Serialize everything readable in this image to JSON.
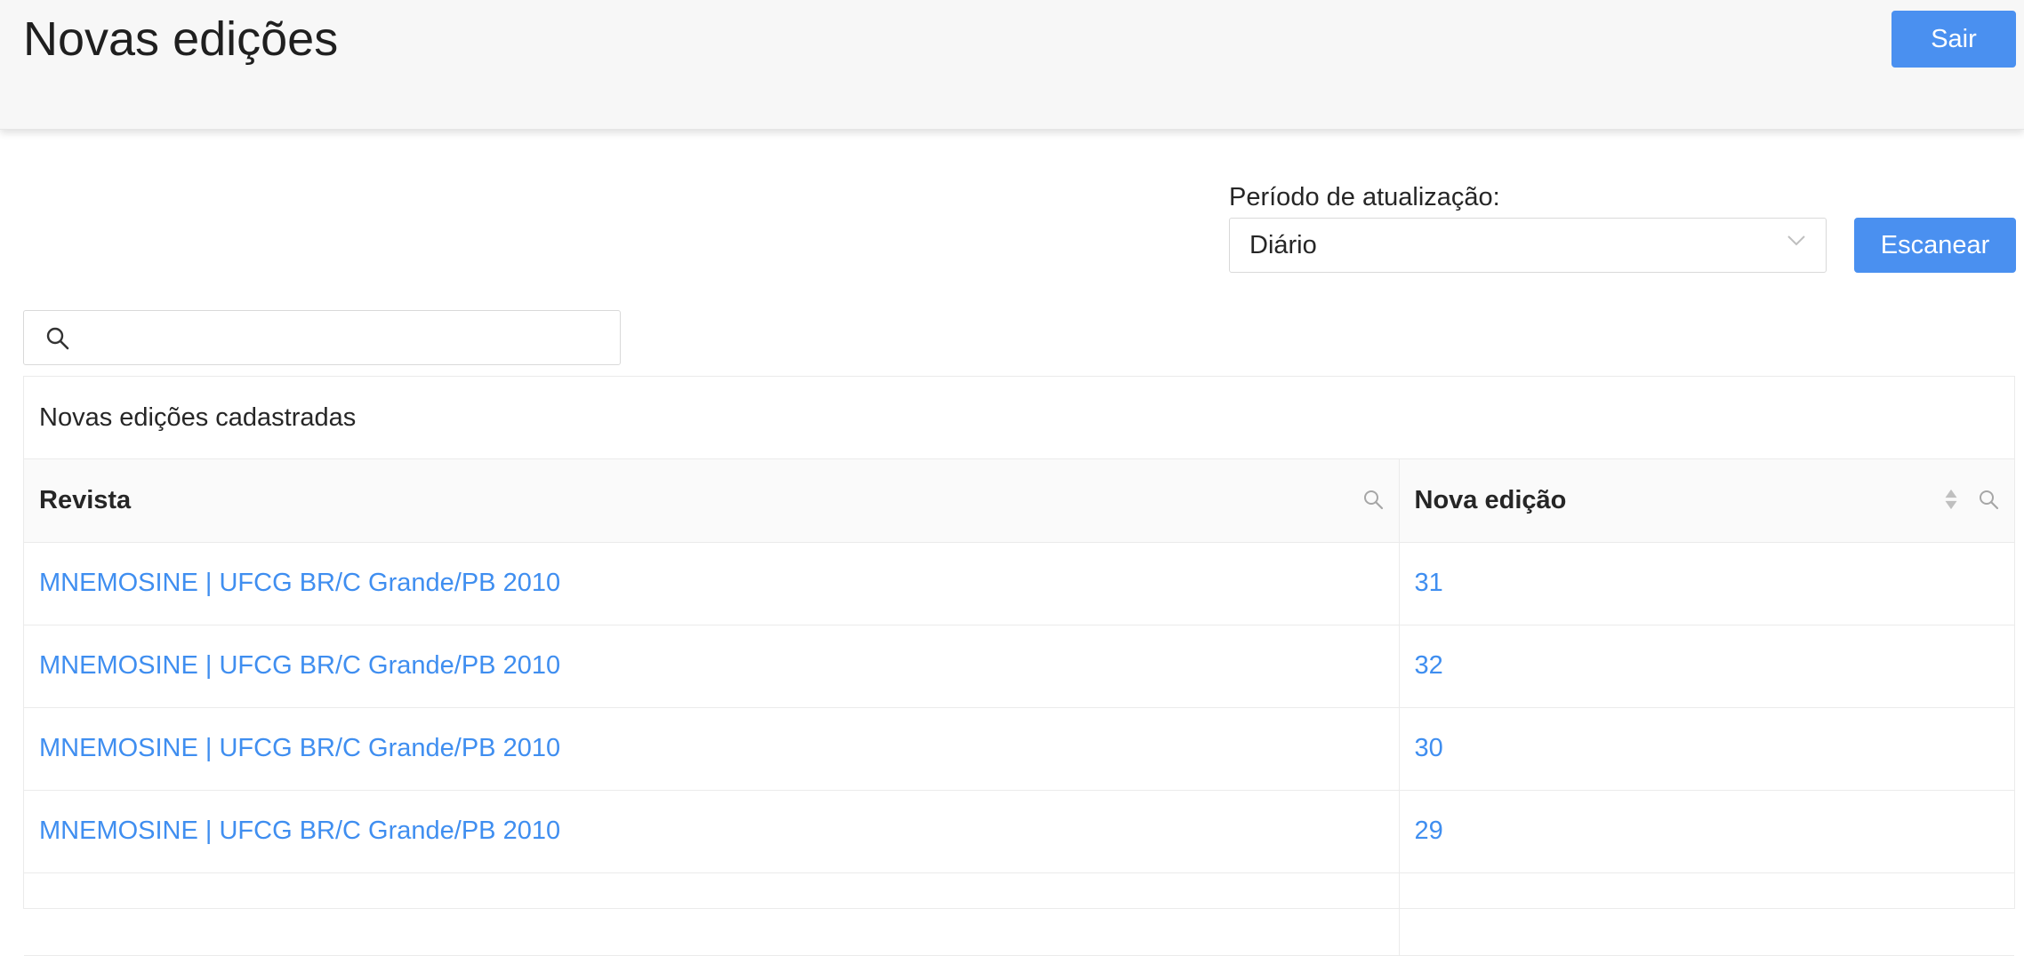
{
  "header": {
    "title": "Novas edições",
    "logout_label": "Sair"
  },
  "controls": {
    "period_label": "Período de atualização:",
    "period_value": "Diário",
    "scan_label": "Escanear",
    "search_value": ""
  },
  "table": {
    "title": "Novas edições cadastradas",
    "columns": [
      "Revista",
      "Nova edição"
    ],
    "rows": [
      {
        "revista": "MNEMOSINE | UFCG BR/C Grande/PB 2010",
        "edicao": "31"
      },
      {
        "revista": "MNEMOSINE | UFCG BR/C Grande/PB 2010",
        "edicao": "32"
      },
      {
        "revista": "MNEMOSINE | UFCG BR/C Grande/PB 2010",
        "edicao": "30"
      },
      {
        "revista": "MNEMOSINE | UFCG BR/C Grande/PB 2010",
        "edicao": "29"
      },
      {
        "revista": "",
        "edicao": ""
      }
    ]
  },
  "colors": {
    "primary": "#4a90f0",
    "link": "#3f8ef0",
    "header_bg": "#f7f7f7"
  }
}
